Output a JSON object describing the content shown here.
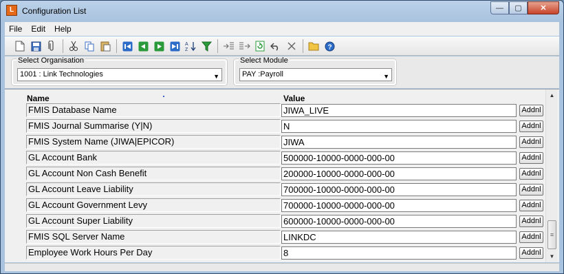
{
  "window": {
    "title": "Configuration List",
    "app_icon_letter": "L",
    "buttons": {
      "minimize": "—",
      "maximize": "▢",
      "close": "✕"
    }
  },
  "menu": [
    "File",
    "Edit",
    "Help"
  ],
  "toolbar": {
    "icons": [
      "new-icon",
      "save-icon",
      "attach-icon",
      "cut-icon",
      "copy-icon",
      "paste-icon",
      "first-record-icon",
      "previous-record-icon",
      "next-record-icon",
      "last-record-icon",
      "sort-icon",
      "filter-icon",
      "indent-icon",
      "outdent-icon",
      "refresh-icon",
      "undo-icon",
      "delete-icon",
      "open-folder-icon",
      "help-icon"
    ]
  },
  "filters": {
    "organisation": {
      "label": "Select Organisation",
      "value": "1001  :  Link Technologies"
    },
    "module": {
      "label": "Select Module",
      "value": "PAY  :Payroll"
    }
  },
  "grid": {
    "headers": {
      "name": "Name",
      "value": "Value"
    },
    "addnl_label": "Addnl",
    "rows": [
      {
        "name": "FMIS Database Name",
        "value": "JIWA_LIVE"
      },
      {
        "name": "FMIS Journal Summarise (Y|N)",
        "value": "N"
      },
      {
        "name": "FMIS System Name (JIWA|EPICOR)",
        "value": "JIWA"
      },
      {
        "name": "GL Account Bank",
        "value": "500000-10000-0000-000-00"
      },
      {
        "name": "GL Account Non Cash Benefit",
        "value": "200000-10000-0000-000-00"
      },
      {
        "name": "GL Account Leave Liability",
        "value": "700000-10000-0000-000-00"
      },
      {
        "name": "GL Account Government Levy",
        "value": "700000-10000-0000-000-00"
      },
      {
        "name": "GL Account Super Liability",
        "value": "600000-10000-0000-000-00"
      },
      {
        "name": "FMIS SQL Server Name",
        "value": "LINKDC"
      },
      {
        "name": "Employee Work Hours Per Day",
        "value": "8"
      }
    ]
  }
}
